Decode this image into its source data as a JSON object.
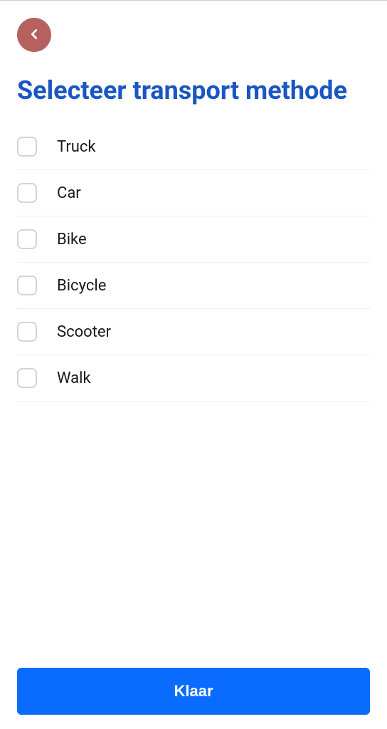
{
  "title": "Selecteer transport methode",
  "options": [
    {
      "label": "Truck"
    },
    {
      "label": "Car"
    },
    {
      "label": "Bike"
    },
    {
      "label": "Bicycle"
    },
    {
      "label": "Scooter"
    },
    {
      "label": "Walk"
    }
  ],
  "footer": {
    "primary_label": "Klaar"
  }
}
